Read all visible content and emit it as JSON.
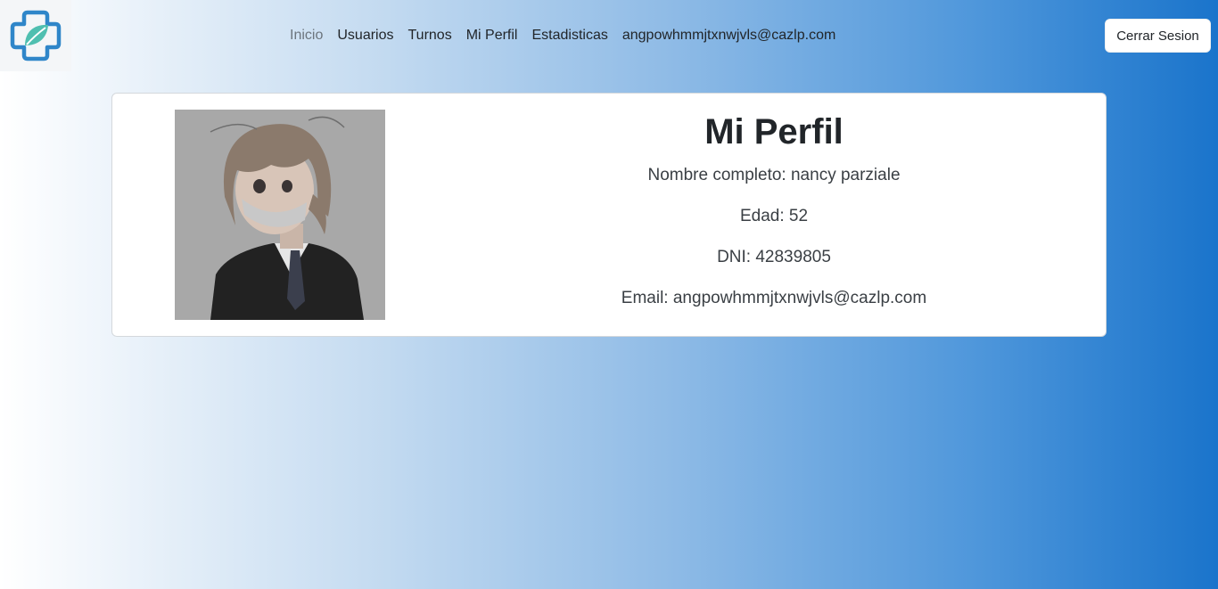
{
  "nav": {
    "links": [
      "Inicio",
      "Usuarios",
      "Turnos",
      "Mi Perfil",
      "Estadisticas",
      "angpowhmmjtxnwjvls@cazlp.com"
    ],
    "logout_label": "Cerrar Sesion"
  },
  "profile": {
    "title": "Mi Perfil",
    "full_name": "Nombre completo: nancy parziale",
    "age": "Edad: 52",
    "dni": "DNI: 42839805",
    "email": "Email: angpowhmmjtxnwjvls@cazlp.com"
  },
  "colors": {
    "logo_blue": "#2f86c9",
    "logo_teal": "#4fbfb0",
    "gradient_end": "#1a74cb"
  },
  "icons": {
    "logo": "medical-cross-leaf-icon"
  }
}
